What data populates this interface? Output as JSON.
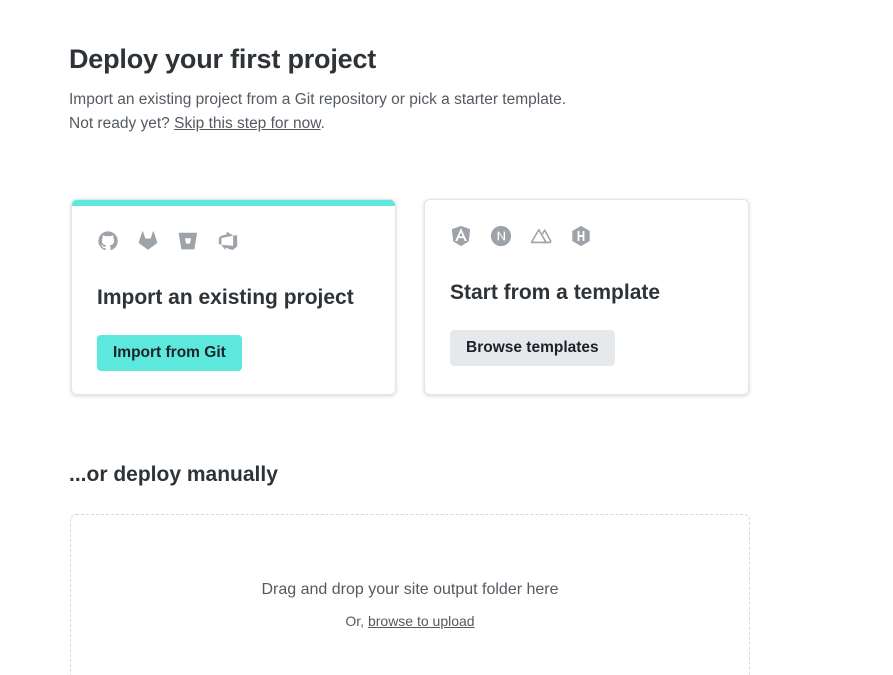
{
  "header": {
    "title": "Deploy your first project",
    "description": "Import an existing project from a Git repository or pick a starter template.",
    "not_ready_prefix": "Not ready yet?",
    "skip_link": "Skip this step for now",
    "not_ready_suffix": "."
  },
  "import_card": {
    "accent_color": "#5ce8dc",
    "icons": [
      "github-icon",
      "gitlab-icon",
      "bitbucket-icon",
      "azure-devops-icon"
    ],
    "title": "Import an existing project",
    "button_label": "Import from Git"
  },
  "template_card": {
    "icons": [
      "angular-icon",
      "nextjs-icon",
      "nuxt-icon",
      "hugo-icon"
    ],
    "title": "Start from a template",
    "button_label": "Browse templates"
  },
  "manual": {
    "title": "...or deploy manually",
    "drop_text": "Drag and drop your site output folder here",
    "or_prefix": "Or,",
    "browse_link": "browse to upload"
  },
  "colors": {
    "accent": "#5ce8dc",
    "text": "#2e3338",
    "muted_text": "#545a61",
    "icon_gray": "#9da3a9",
    "secondary_button": "#e6e9ec"
  }
}
